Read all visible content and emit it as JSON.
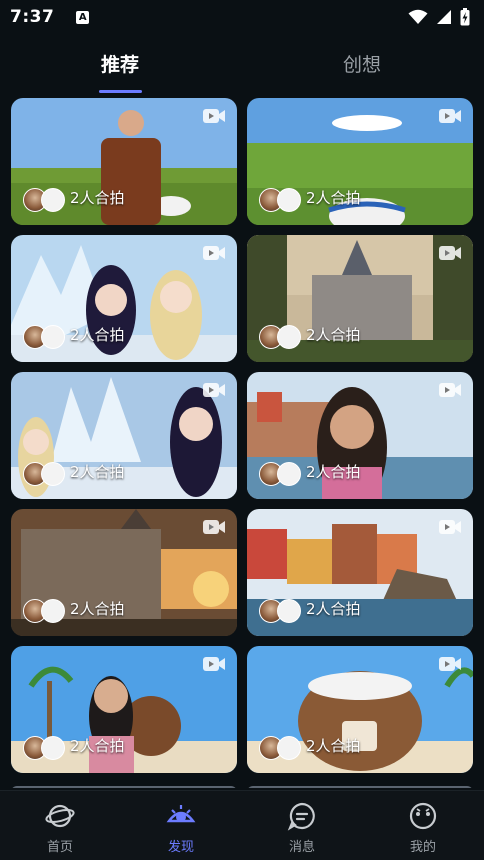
{
  "status_bar": {
    "time": "7:37",
    "notification_badge": "A"
  },
  "tabs": [
    {
      "label": "推荐",
      "active": true
    },
    {
      "label": "创想",
      "active": false
    }
  ],
  "cards": [
    {
      "label": "2人合拍",
      "scene": "man-in-suit-on-grassland",
      "icon": "video-icon"
    },
    {
      "label": "2人合拍",
      "scene": "grassland-yurt",
      "icon": "video-icon"
    },
    {
      "label": "2人合拍",
      "scene": "two-girls-ice-castle",
      "icon": "video-icon"
    },
    {
      "label": "2人合拍",
      "scene": "european-castle",
      "icon": "video-icon"
    },
    {
      "label": "2人合拍",
      "scene": "ice-castle-girls",
      "icon": "video-icon"
    },
    {
      "label": "2人合拍",
      "scene": "woman-seaside-town",
      "icon": "video-icon"
    },
    {
      "label": "2人合拍",
      "scene": "castle-sunset",
      "icon": "video-icon"
    },
    {
      "label": "2人合拍",
      "scene": "colorful-seaside-town",
      "icon": "video-icon"
    },
    {
      "label": "2人合拍",
      "scene": "woman-beach-coconut",
      "icon": "video-icon"
    },
    {
      "label": "2人合拍",
      "scene": "coconut-house-beach",
      "icon": "video-icon"
    }
  ],
  "bottom_nav": [
    {
      "label": "首页",
      "icon": "planet-icon",
      "active": false
    },
    {
      "label": "发现",
      "icon": "discover-eye-icon",
      "active": true
    },
    {
      "label": "消息",
      "icon": "message-icon",
      "active": false
    },
    {
      "label": "我的",
      "icon": "profile-icon",
      "active": false
    }
  ],
  "colors": {
    "background": "#0a1014",
    "accent": "#6c7cff",
    "inactive": "#9aa0a6"
  }
}
